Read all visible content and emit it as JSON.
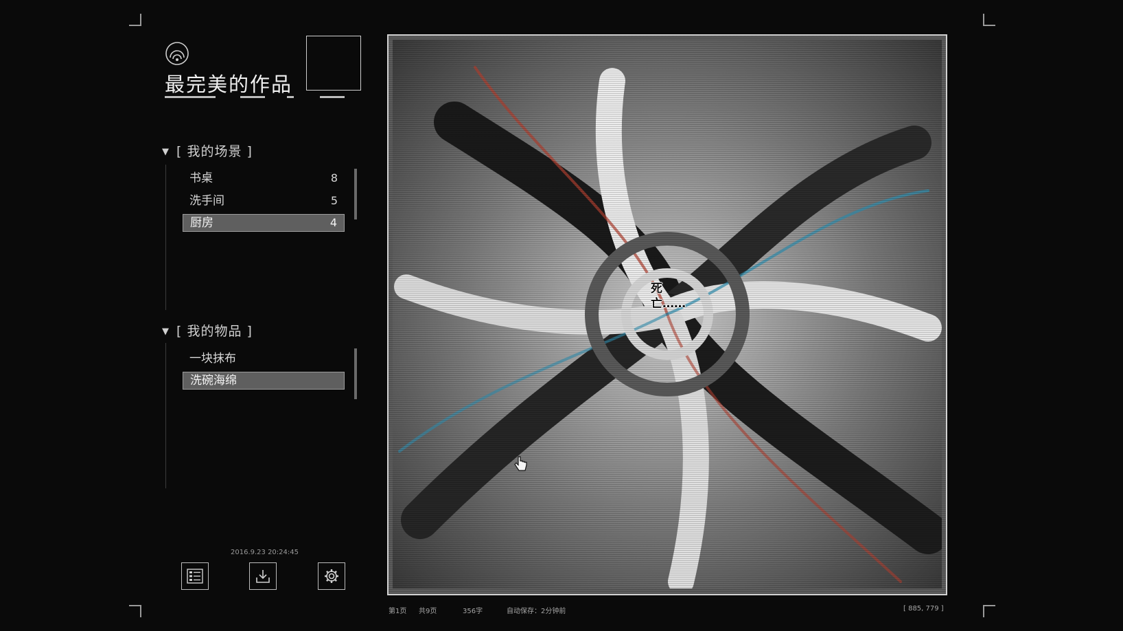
{
  "document": {
    "title": "最完美的作品"
  },
  "scenes": {
    "header": "[ 我的场景 ]",
    "items": [
      {
        "name": "书桌",
        "count": "8"
      },
      {
        "name": "洗手间",
        "count": "5"
      },
      {
        "name": "厨房",
        "count": "4"
      }
    ],
    "selected": "厨房"
  },
  "objects": {
    "header": "[ 我的物品 ]",
    "items": [
      {
        "name": "一块抹布"
      },
      {
        "name": "洗碗海绵"
      }
    ],
    "selected": "洗碗海绵"
  },
  "footer": {
    "timestamp": "2016.9.23 20:24:45"
  },
  "toolbar": {
    "icons": [
      "list-icon",
      "download-icon",
      "gear-icon"
    ]
  },
  "viewer": {
    "caption_line1": "死",
    "caption_line2": "亡……"
  },
  "status": {
    "page": "第1页",
    "total": "共9页",
    "words": "356字",
    "autosave": "自动保存：2分钟前",
    "coords": "[ 885, 779 ]"
  },
  "colors": {
    "background": "#0a0a0a",
    "selected_row": "#5f5f5f",
    "frame": "#d2d2d2",
    "text": "#d6d6d6"
  }
}
